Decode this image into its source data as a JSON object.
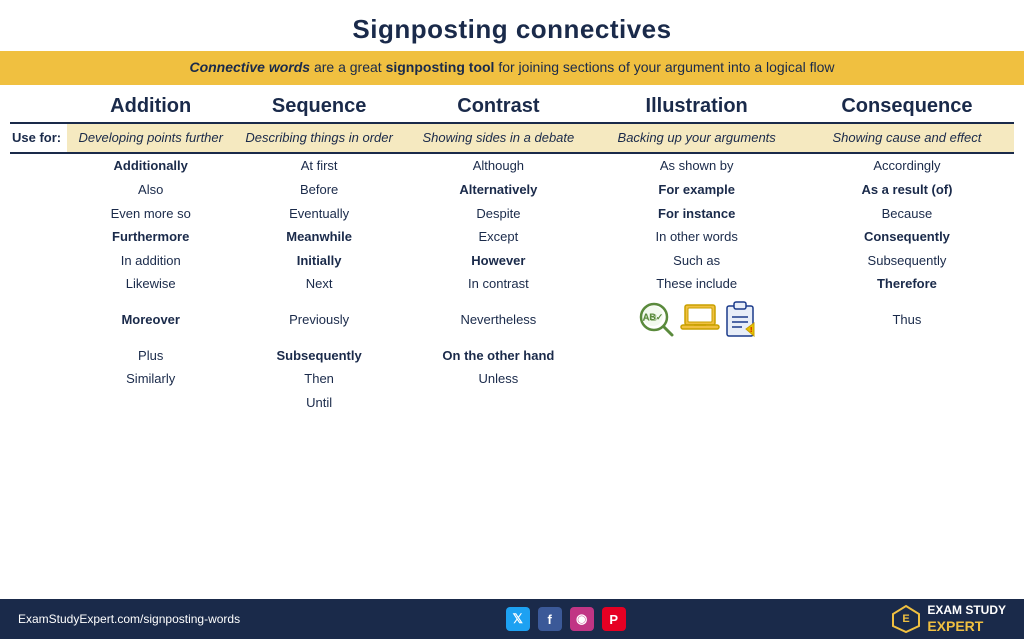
{
  "title": "Signposting connectives",
  "subtitle": {
    "part1": "Connective words",
    "part2": " are a great ",
    "part3": "signposting tool",
    "part4": " for joining sections of your argument into a logical flow"
  },
  "columns": {
    "addition": "Addition",
    "sequence": "Sequence",
    "contrast": "Contrast",
    "illustration": "Illustration",
    "consequence": "Consequence"
  },
  "usefor_label": "Use for:",
  "usefor": {
    "addition": "Developing points further",
    "sequence": "Describing things in order",
    "contrast": "Showing sides in a debate",
    "illustration": "Backing up your arguments",
    "consequence": "Showing cause and effect"
  },
  "words": {
    "addition": [
      {
        "text": "Additionally",
        "bold": true
      },
      {
        "text": "Also",
        "bold": false
      },
      {
        "text": "Even more so",
        "bold": false
      },
      {
        "text": "Furthermore",
        "bold": true
      },
      {
        "text": "In addition",
        "bold": false
      },
      {
        "text": "Likewise",
        "bold": false
      },
      {
        "text": "Moreover",
        "bold": true
      },
      {
        "text": "Plus",
        "bold": false
      },
      {
        "text": "Similarly",
        "bold": false
      }
    ],
    "sequence": [
      {
        "text": "At first",
        "bold": false
      },
      {
        "text": "Before",
        "bold": false
      },
      {
        "text": "Eventually",
        "bold": false
      },
      {
        "text": "Meanwhile",
        "bold": true
      },
      {
        "text": "Initially",
        "bold": true
      },
      {
        "text": "Next",
        "bold": false
      },
      {
        "text": "Previously",
        "bold": false
      },
      {
        "text": "Subsequently",
        "bold": true
      },
      {
        "text": "Then",
        "bold": false
      },
      {
        "text": "Until",
        "bold": false
      }
    ],
    "contrast": [
      {
        "text": "Although",
        "bold": false
      },
      {
        "text": "Alternatively",
        "bold": true
      },
      {
        "text": "Despite",
        "bold": false
      },
      {
        "text": "Except",
        "bold": false
      },
      {
        "text": "However",
        "bold": true
      },
      {
        "text": "In contrast",
        "bold": false
      },
      {
        "text": "Nevertheless",
        "bold": false
      },
      {
        "text": "On the other hand",
        "bold": true
      },
      {
        "text": "Unless",
        "bold": false
      }
    ],
    "illustration": [
      {
        "text": "As shown by",
        "bold": false
      },
      {
        "text": "For example",
        "bold": true
      },
      {
        "text": "For instance",
        "bold": true
      },
      {
        "text": "In other words",
        "bold": false
      },
      {
        "text": "Such as",
        "bold": false
      },
      {
        "text": "These include",
        "bold": false
      }
    ],
    "consequence": [
      {
        "text": "Accordingly",
        "bold": false
      },
      {
        "text": "As a result (of)",
        "bold": true
      },
      {
        "text": "Because",
        "bold": false
      },
      {
        "text": "Consequently",
        "bold": true
      },
      {
        "text": "Subsequently",
        "bold": false
      },
      {
        "text": "Therefore",
        "bold": true
      },
      {
        "text": "Thus",
        "bold": false
      }
    ]
  },
  "footer": {
    "url": "ExamStudyExpert.com/signposting-words",
    "brand_line1": "EXAM STUDY",
    "brand_line2": "EXPERT"
  }
}
